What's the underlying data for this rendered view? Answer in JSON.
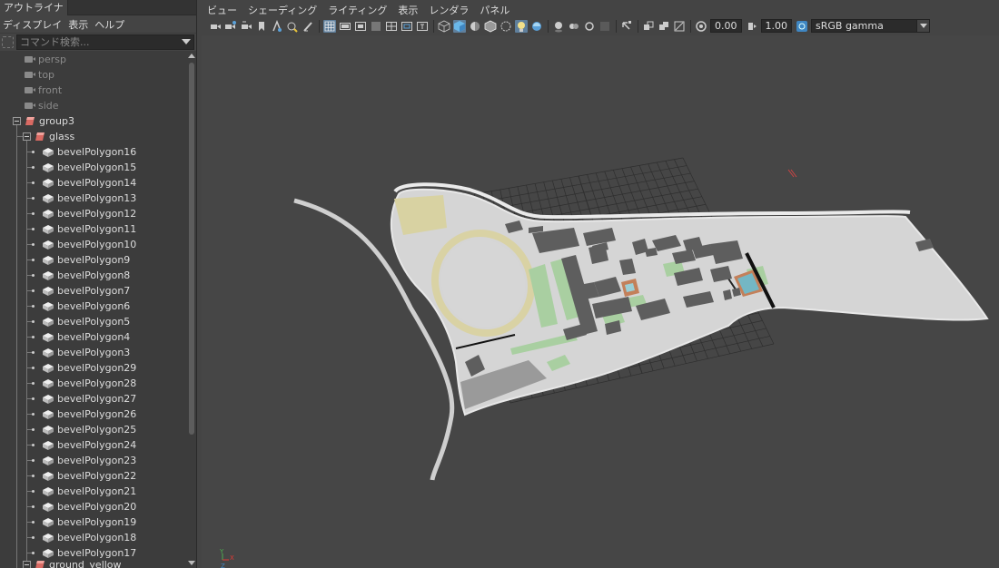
{
  "outliner": {
    "tab_title": "アウトライナ",
    "menu": [
      "ディスプレイ",
      "表示",
      "ヘルプ"
    ],
    "search_placeholder": "コマンド検索...",
    "cameras": [
      "persp",
      "top",
      "front",
      "side"
    ],
    "group": "group3",
    "subgroup": "glass",
    "meshes": [
      "bevelPolygon16",
      "bevelPolygon15",
      "bevelPolygon14",
      "bevelPolygon13",
      "bevelPolygon12",
      "bevelPolygon11",
      "bevelPolygon10",
      "bevelPolygon9",
      "bevelPolygon8",
      "bevelPolygon7",
      "bevelPolygon6",
      "bevelPolygon5",
      "bevelPolygon4",
      "bevelPolygon3",
      "bevelPolygon29",
      "bevelPolygon28",
      "bevelPolygon27",
      "bevelPolygon26",
      "bevelPolygon25",
      "bevelPolygon24",
      "bevelPolygon23",
      "bevelPolygon22",
      "bevelPolygon21",
      "bevelPolygon20",
      "bevelPolygon19",
      "bevelPolygon18",
      "bevelPolygon17"
    ],
    "next_group": "ground_yellow"
  },
  "viewport": {
    "menu": [
      "ビュー",
      "シェーディング",
      "ライティング",
      "表示",
      "レンダラ",
      "パネル"
    ],
    "exposure": "0.00",
    "gamma": "1.00",
    "color_space": "sRGB gamma",
    "axis": {
      "x": "X",
      "y": "Y",
      "z": "Z"
    }
  },
  "colors": {
    "viewport_bg": "#464646",
    "ground": "#d3d3d3",
    "field": "#d8d2a2",
    "track": "#d9d2a4",
    "lawn": "#a9cfa1",
    "building": "#5e5e5e",
    "pool": "#74b7c4",
    "brick": "#c3805a",
    "grid": "#2e2e2e"
  }
}
